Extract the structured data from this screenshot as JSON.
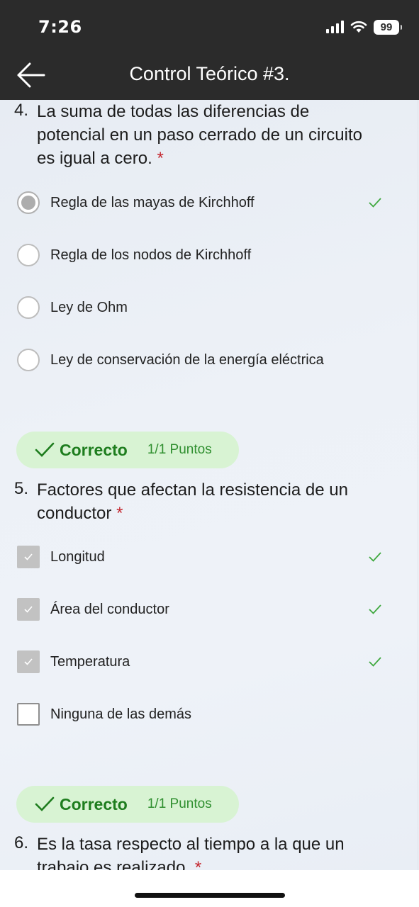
{
  "status_bar": {
    "time": "7:26",
    "battery": "99"
  },
  "header": {
    "title": "Control Teórico #3."
  },
  "questions": [
    {
      "number": "4.",
      "lines": [
        "La suma de todas las diferencias de",
        "potencial en un paso cerrado de un circuito",
        "es igual a cero."
      ],
      "required_mark": "*",
      "options": [
        {
          "label": "Regla de las mayas de Kirchhoff",
          "selected": true,
          "marked_correct": true
        },
        {
          "label": "Regla de los nodos de Kirchhoff",
          "selected": false,
          "marked_correct": false
        },
        {
          "label": "Ley de Ohm",
          "selected": false,
          "marked_correct": false
        },
        {
          "label": "Ley de conservación de la energía eléctrica",
          "selected": false,
          "marked_correct": false
        }
      ]
    },
    {
      "number": "5.",
      "lines": [
        "Factores que afectan la resistencia de un",
        "conductor"
      ],
      "required_mark": "*",
      "result": {
        "text": "Correcto",
        "points": "1/1 Puntos"
      },
      "options": [
        {
          "label": "Longitud",
          "selected": true,
          "marked_correct": true
        },
        {
          "label": "Área del conductor",
          "selected": true,
          "marked_correct": true
        },
        {
          "label": "Temperatura",
          "selected": true,
          "marked_correct": true
        },
        {
          "label": "Ninguna de las demás",
          "selected": false,
          "marked_correct": false
        }
      ]
    },
    {
      "number": "6.",
      "lines": [
        "Es la tasa respecto al tiempo a la que un",
        "trabajo es realizado."
      ],
      "required_mark": "*",
      "result": {
        "text": "Correcto",
        "points": "1/1 Puntos"
      }
    }
  ],
  "colors": {
    "header_bg": "#2b2b2b",
    "correct_green": "#1e7d1e",
    "badge_bg": "#d8f3d3",
    "required_red": "#c4262e"
  }
}
